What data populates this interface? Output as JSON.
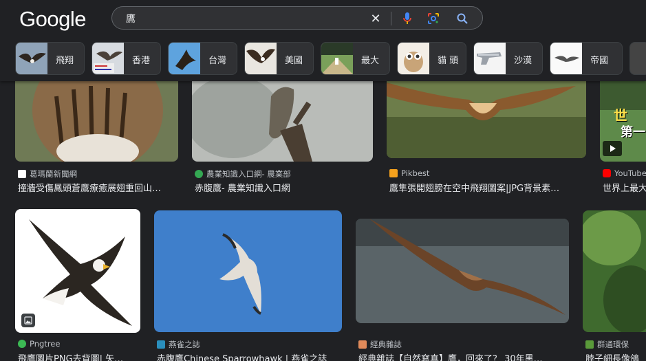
{
  "brand": {
    "logo_text": "Google"
  },
  "search": {
    "query": "鷹",
    "placeholder": ""
  },
  "chips": [
    {
      "label": "飛翔"
    },
    {
      "label": "香港"
    },
    {
      "label": "台灣"
    },
    {
      "label": "美國"
    },
    {
      "label": "最大"
    },
    {
      "label": "貓 頭"
    },
    {
      "label": "沙漠"
    },
    {
      "label": "帝國"
    }
  ],
  "results_row1": [
    {
      "source": "葛瑪蘭新聞網",
      "title": "撞牆受傷鳳頭蒼鷹療癒展翅重回山…"
    },
    {
      "source": "農業知識入口網- 農業部",
      "title": "赤腹鷹- 農業知識入口網"
    },
    {
      "source": "Pikbest",
      "title": "鷹隼張開翅膀在空中飛翔圖案|JPG背景素…"
    },
    {
      "source": "YouTube",
      "title": "世界上最大"
    }
  ],
  "results_row2": [
    {
      "source": "Pngtree",
      "title": "飛鷹圖片PNG去背圖| 矢…"
    },
    {
      "source": "燕雀之誌",
      "title": "赤腹鷹Chinese Sparrowhawk | 燕雀之誌"
    },
    {
      "source": "經典雜誌",
      "title": "經典雜誌【自然寫真】鷹，回來了？ 30年黑…"
    },
    {
      "source": "群通環保",
      "title": "脖子細長像鴿"
    }
  ],
  "video_overlay": {
    "text_line1": "世",
    "text_line2": "第一"
  },
  "colors": {
    "background": "#202124",
    "chip_bg": "#303134",
    "text": "#e8eaed",
    "secondary_text": "#bdc1c6"
  }
}
